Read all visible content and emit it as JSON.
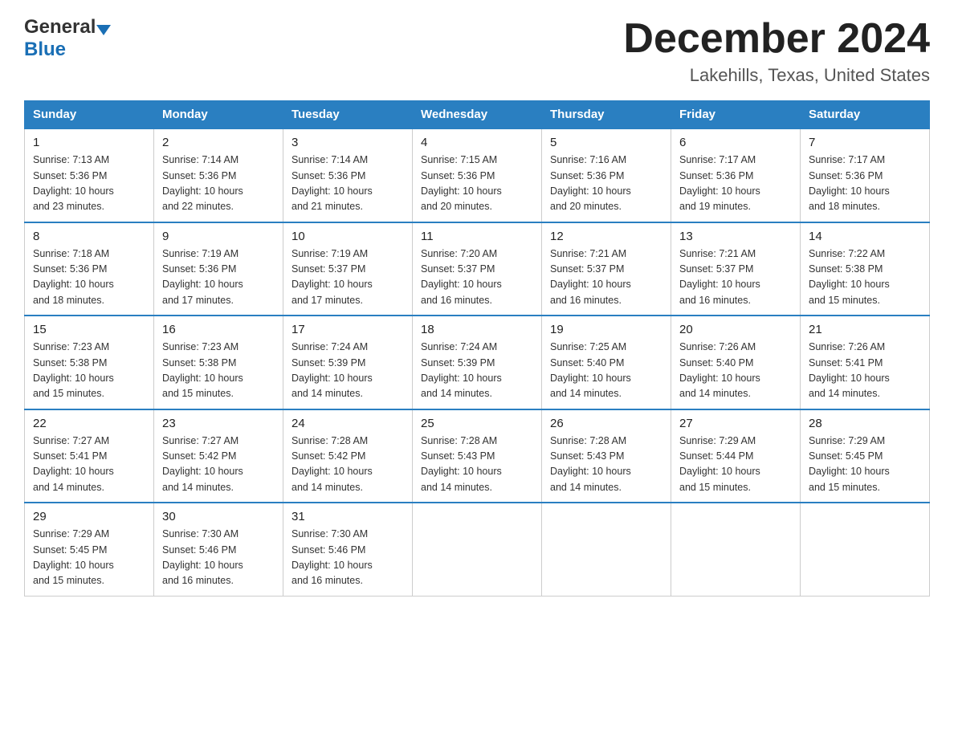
{
  "header": {
    "logo_general": "General",
    "logo_blue": "Blue",
    "month_title": "December 2024",
    "location": "Lakehills, Texas, United States"
  },
  "days_of_week": [
    "Sunday",
    "Monday",
    "Tuesday",
    "Wednesday",
    "Thursday",
    "Friday",
    "Saturday"
  ],
  "weeks": [
    [
      {
        "day": "1",
        "sunrise": "7:13 AM",
        "sunset": "5:36 PM",
        "daylight": "10 hours and 23 minutes."
      },
      {
        "day": "2",
        "sunrise": "7:14 AM",
        "sunset": "5:36 PM",
        "daylight": "10 hours and 22 minutes."
      },
      {
        "day": "3",
        "sunrise": "7:14 AM",
        "sunset": "5:36 PM",
        "daylight": "10 hours and 21 minutes."
      },
      {
        "day": "4",
        "sunrise": "7:15 AM",
        "sunset": "5:36 PM",
        "daylight": "10 hours and 20 minutes."
      },
      {
        "day": "5",
        "sunrise": "7:16 AM",
        "sunset": "5:36 PM",
        "daylight": "10 hours and 20 minutes."
      },
      {
        "day": "6",
        "sunrise": "7:17 AM",
        "sunset": "5:36 PM",
        "daylight": "10 hours and 19 minutes."
      },
      {
        "day": "7",
        "sunrise": "7:17 AM",
        "sunset": "5:36 PM",
        "daylight": "10 hours and 18 minutes."
      }
    ],
    [
      {
        "day": "8",
        "sunrise": "7:18 AM",
        "sunset": "5:36 PM",
        "daylight": "10 hours and 18 minutes."
      },
      {
        "day": "9",
        "sunrise": "7:19 AM",
        "sunset": "5:36 PM",
        "daylight": "10 hours and 17 minutes."
      },
      {
        "day": "10",
        "sunrise": "7:19 AM",
        "sunset": "5:37 PM",
        "daylight": "10 hours and 17 minutes."
      },
      {
        "day": "11",
        "sunrise": "7:20 AM",
        "sunset": "5:37 PM",
        "daylight": "10 hours and 16 minutes."
      },
      {
        "day": "12",
        "sunrise": "7:21 AM",
        "sunset": "5:37 PM",
        "daylight": "10 hours and 16 minutes."
      },
      {
        "day": "13",
        "sunrise": "7:21 AM",
        "sunset": "5:37 PM",
        "daylight": "10 hours and 16 minutes."
      },
      {
        "day": "14",
        "sunrise": "7:22 AM",
        "sunset": "5:38 PM",
        "daylight": "10 hours and 15 minutes."
      }
    ],
    [
      {
        "day": "15",
        "sunrise": "7:23 AM",
        "sunset": "5:38 PM",
        "daylight": "10 hours and 15 minutes."
      },
      {
        "day": "16",
        "sunrise": "7:23 AM",
        "sunset": "5:38 PM",
        "daylight": "10 hours and 15 minutes."
      },
      {
        "day": "17",
        "sunrise": "7:24 AM",
        "sunset": "5:39 PM",
        "daylight": "10 hours and 14 minutes."
      },
      {
        "day": "18",
        "sunrise": "7:24 AM",
        "sunset": "5:39 PM",
        "daylight": "10 hours and 14 minutes."
      },
      {
        "day": "19",
        "sunrise": "7:25 AM",
        "sunset": "5:40 PM",
        "daylight": "10 hours and 14 minutes."
      },
      {
        "day": "20",
        "sunrise": "7:26 AM",
        "sunset": "5:40 PM",
        "daylight": "10 hours and 14 minutes."
      },
      {
        "day": "21",
        "sunrise": "7:26 AM",
        "sunset": "5:41 PM",
        "daylight": "10 hours and 14 minutes."
      }
    ],
    [
      {
        "day": "22",
        "sunrise": "7:27 AM",
        "sunset": "5:41 PM",
        "daylight": "10 hours and 14 minutes."
      },
      {
        "day": "23",
        "sunrise": "7:27 AM",
        "sunset": "5:42 PM",
        "daylight": "10 hours and 14 minutes."
      },
      {
        "day": "24",
        "sunrise": "7:28 AM",
        "sunset": "5:42 PM",
        "daylight": "10 hours and 14 minutes."
      },
      {
        "day": "25",
        "sunrise": "7:28 AM",
        "sunset": "5:43 PM",
        "daylight": "10 hours and 14 minutes."
      },
      {
        "day": "26",
        "sunrise": "7:28 AM",
        "sunset": "5:43 PM",
        "daylight": "10 hours and 14 minutes."
      },
      {
        "day": "27",
        "sunrise": "7:29 AM",
        "sunset": "5:44 PM",
        "daylight": "10 hours and 15 minutes."
      },
      {
        "day": "28",
        "sunrise": "7:29 AM",
        "sunset": "5:45 PM",
        "daylight": "10 hours and 15 minutes."
      }
    ],
    [
      {
        "day": "29",
        "sunrise": "7:29 AM",
        "sunset": "5:45 PM",
        "daylight": "10 hours and 15 minutes."
      },
      {
        "day": "30",
        "sunrise": "7:30 AM",
        "sunset": "5:46 PM",
        "daylight": "10 hours and 16 minutes."
      },
      {
        "day": "31",
        "sunrise": "7:30 AM",
        "sunset": "5:46 PM",
        "daylight": "10 hours and 16 minutes."
      },
      null,
      null,
      null,
      null
    ]
  ],
  "labels": {
    "sunrise_prefix": "Sunrise: ",
    "sunset_prefix": "Sunset: ",
    "daylight_prefix": "Daylight: "
  }
}
